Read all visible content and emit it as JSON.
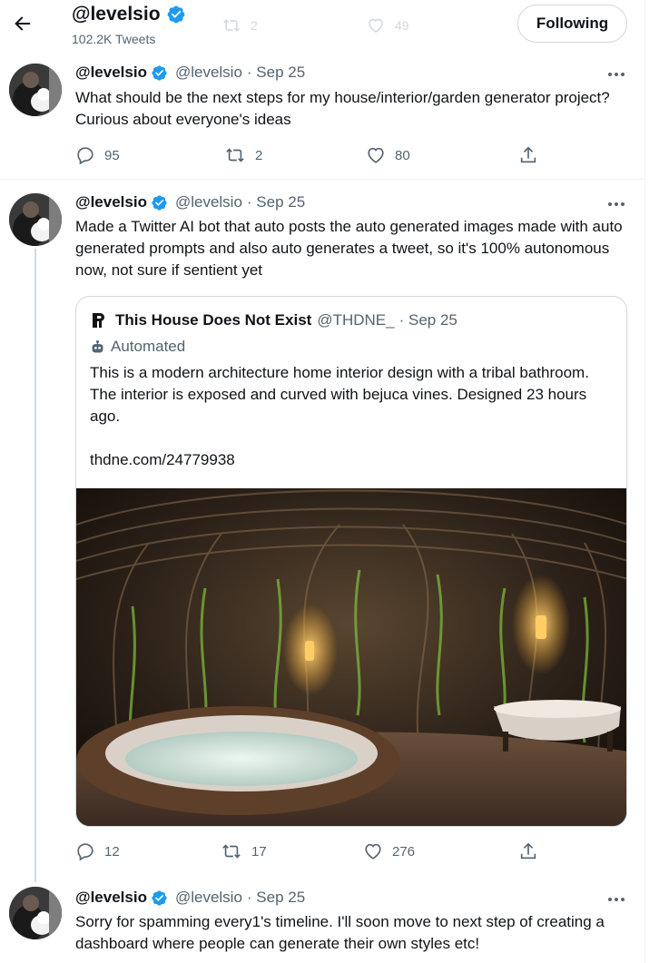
{
  "header": {
    "name": "@levelsio",
    "tweet_count": "102.2K Tweets",
    "ghost_retweets": "2",
    "ghost_likes": "49",
    "follow_label": "Following"
  },
  "tweets": [
    {
      "name": "@levelsio",
      "handle": "@levelsio",
      "date": "· Sep 25",
      "text": "What should be the next steps for my house/interior/garden generator project? Curious about everyone's ideas",
      "replies": "95",
      "retweets": "2",
      "likes": "80"
    },
    {
      "name": "@levelsio",
      "handle": "@levelsio",
      "date": "· Sep 25",
      "text": "Made a Twitter AI bot that auto posts the auto generated images made with auto generated prompts and also auto generates a tweet, so it's 100% autonomous now, not sure if sentient yet",
      "replies": "12",
      "retweets": "17",
      "likes": "276",
      "quote": {
        "name": "This House Does Not Exist",
        "handle": "@THDNE_",
        "date": "· Sep 25",
        "label": "Automated",
        "text": "This is a modern architecture home interior design with a tribal bathroom. The interior is exposed and curved with bejuca vines. Designed 23 hours ago.",
        "link": "thdne.com/24779938"
      }
    },
    {
      "name": "@levelsio",
      "handle": "@levelsio",
      "date": "· Sep 25",
      "text": "Sorry for spamming every1's timeline. I'll soon move to next step of creating a dashboard where people can generate their own styles etc!"
    }
  ],
  "colors": {
    "accent": "#1d9bf0",
    "text": "#0f1419",
    "secondary": "#536471",
    "border": "#cfd9de"
  },
  "icons": {
    "back": "arrow-left-icon",
    "verified": "verified-badge-icon",
    "more": "more-icon",
    "reply": "reply-icon",
    "retweet": "retweet-icon",
    "like": "heart-icon",
    "share": "share-icon",
    "automated": "bot-icon",
    "quote_avatar": "house-logo-icon"
  }
}
